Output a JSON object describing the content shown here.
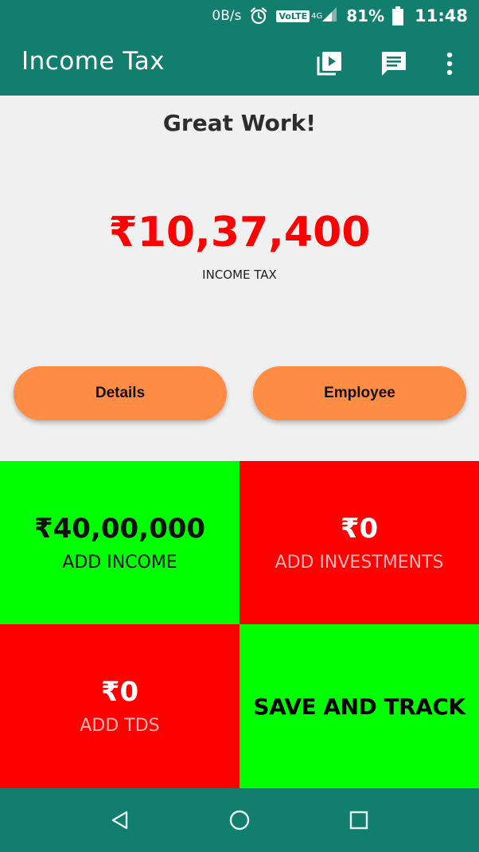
{
  "status_bar": {
    "net_speed": "0B/s",
    "network_badge": "VoLTE",
    "network_type": "4G",
    "battery": "81%",
    "time": "11:48",
    "icons": [
      "alarm-icon",
      "signal-icon",
      "battery-icon"
    ]
  },
  "app_bar": {
    "title": "Income Tax",
    "actions": [
      "video-library-icon",
      "chat-icon",
      "more-vert-icon"
    ]
  },
  "summary": {
    "headline": "Great Work!",
    "amount": "₹10,37,400",
    "amount_label": "INCOME TAX",
    "amount_color": "#ff0000"
  },
  "buttons": {
    "details": "Details",
    "employee": "Employee",
    "color": "#ff8c45"
  },
  "tiles": {
    "income": {
      "value": "₹40,00,000",
      "label": "ADD INCOME",
      "color": "#00ff00"
    },
    "investments": {
      "value": "₹0",
      "label": "ADD INVESTMENTS",
      "color": "#ff0000"
    },
    "tds": {
      "value": "₹0",
      "label": "ADD TDS",
      "color": "#ff0000"
    },
    "save": {
      "label": "SAVE AND TRACK",
      "color": "#00ff00"
    }
  },
  "nav_bar": {
    "icons": [
      "back-icon",
      "home-icon",
      "recents-icon"
    ]
  },
  "theme": {
    "primary": "#127e6e",
    "background": "#f0f0f0"
  }
}
